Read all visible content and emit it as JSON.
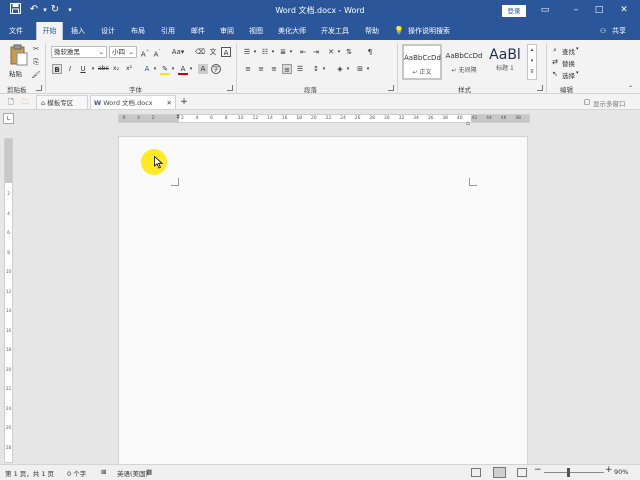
{
  "title": "Word 文档.docx - Word",
  "login_label": "登录",
  "tabs": [
    "文件",
    "开始",
    "插入",
    "设计",
    "布局",
    "引用",
    "邮件",
    "审阅",
    "视图",
    "美化大师",
    "开发工具",
    "帮助"
  ],
  "tell_me": "操作说明搜索",
  "share_label": "共享",
  "clipboard": {
    "paste_label": "粘贴",
    "group_label": "剪贴板"
  },
  "font": {
    "name": "微软雅黑",
    "size": "小四",
    "group_label": "字体",
    "sub_label": "x₂",
    "sup_label": "x²",
    "color_accent": "#d00000",
    "highlight_accent": "#ffe600"
  },
  "paragraph": {
    "group_label": "段落"
  },
  "styles": {
    "items": [
      {
        "sample": "AaBbCcDd",
        "name": "↵ 正文"
      },
      {
        "sample": "AaBbCcDd",
        "name": "↵ 无间隔"
      },
      {
        "sample": "AaBl",
        "name": "标题 1"
      }
    ],
    "group_label": "样式"
  },
  "editing": {
    "find_label": "查找",
    "replace_label": "替换",
    "select_label": "选择",
    "group_label": "编辑"
  },
  "doc_tabs": {
    "template_label": "模板专区",
    "doc_label": "Word 文档.docx",
    "multi_window_label": "显示多窗口"
  },
  "ruler": {
    "h_ticks": [
      "6",
      "4",
      "2",
      "",
      "2",
      "4",
      "6",
      "8",
      "10",
      "12",
      "14",
      "16",
      "18",
      "20",
      "22",
      "24",
      "26",
      "28",
      "30",
      "32",
      "34",
      "36",
      "38",
      "40",
      "42",
      "44",
      "46",
      "48"
    ],
    "v_ticks": [
      "2",
      "4",
      "6",
      "8",
      "10",
      "12",
      "14",
      "16",
      "18",
      "20",
      "22",
      "24",
      "26",
      "28"
    ]
  },
  "status": {
    "page": "第 1 页，共 1 页",
    "words": "0 个字",
    "lang": "英语(美国)",
    "zoom": "90%"
  },
  "colors": {
    "accent": "#2b579a",
    "highlight": "#ffe600"
  }
}
